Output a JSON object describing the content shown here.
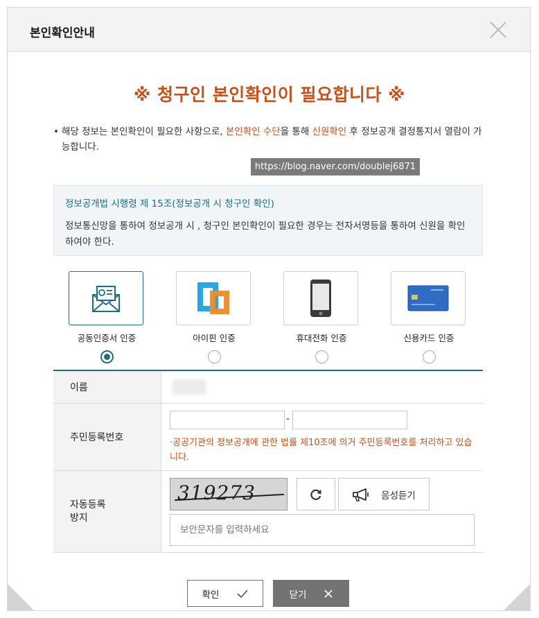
{
  "dialog": {
    "title": "본인확인안내"
  },
  "headline": "※ 청구인 본인확인이 필요합니다 ※",
  "notice": {
    "bullet": "•",
    "part1": "해당 정보는 본인확인이 필요한 사항으로, ",
    "highlight1": "본인확인 수단",
    "part2": "을 통해 ",
    "highlight2": "신원확인",
    "part3": " 후 정보공개 결정통지서 열람이 가능합니다."
  },
  "watermark": "https://blog.naver.com/doublej6871",
  "law": {
    "title": "정보공개법 시행령 제 15조(정보공개 시 청구인 확인)",
    "body": "정보통신망을 통하여 정보공개 시 , 청구인 본인확인이 필요한 경우는 전자서명등을 통하여 신원을 확인하여야 한다."
  },
  "methods": [
    {
      "label": "공동인증서 인증",
      "icon": "certificate-envelope-icon",
      "selected": true
    },
    {
      "label": "아이핀 인증",
      "icon": "ipin-icon",
      "selected": false
    },
    {
      "label": "휴대전화 인증",
      "icon": "mobile-phone-icon",
      "selected": false
    },
    {
      "label": "신용카드 인증",
      "icon": "credit-card-icon",
      "selected": false
    }
  ],
  "form": {
    "name_label": "이름",
    "jumin_label": "주민등록번호",
    "jumin_separator": "-",
    "jumin_note": "·공공기관의 정보공개에 관한 법률 제10조에 의거 주민등록번호를 처리하고 있습니다.",
    "captcha_label_line1": "자동등록",
    "captcha_label_line2": "방지",
    "captcha_text": "319273",
    "audio_label": "음성듣기",
    "captcha_placeholder": "보안문자를 입력하세요"
  },
  "buttons": {
    "confirm": "확인",
    "close": "닫기"
  },
  "colors": {
    "accent": "#1b6e86",
    "highlight": "#c8501a",
    "close_button": "#737373"
  }
}
